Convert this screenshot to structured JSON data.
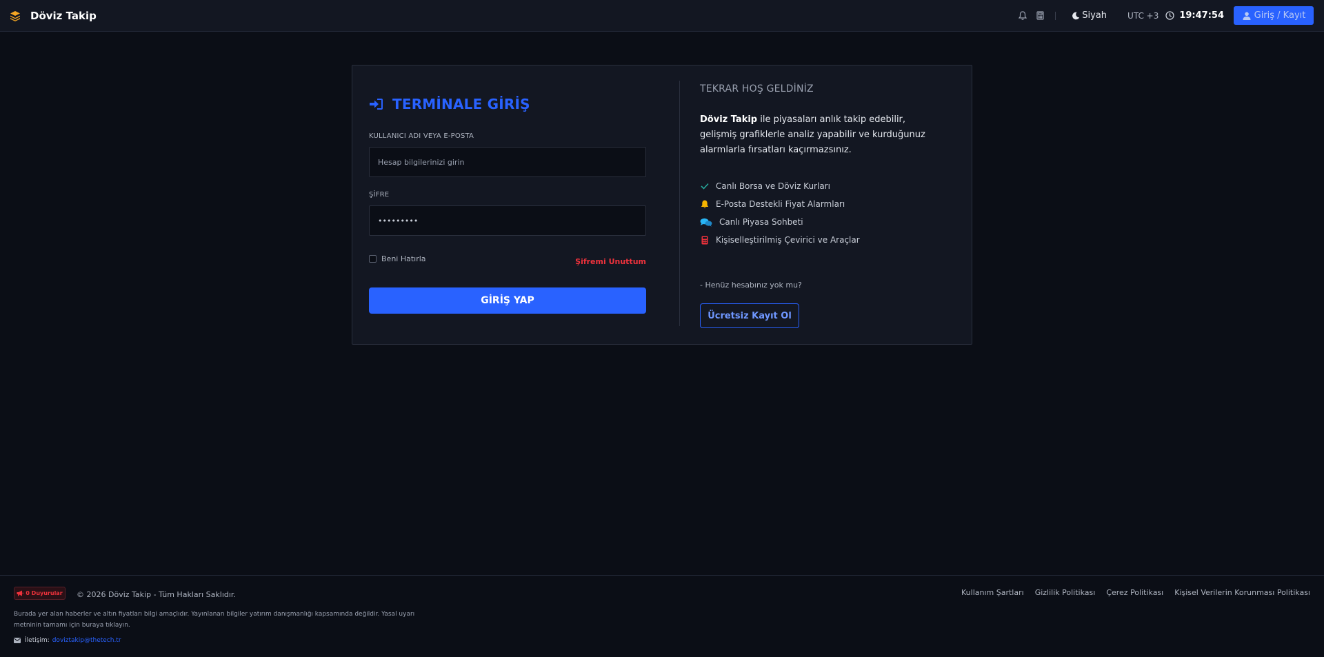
{
  "header": {
    "brand": "Döviz Takip",
    "theme_label": "Siyah",
    "utc_label": "UTC +3",
    "time": "19:47:54",
    "login_button": "Giriş / Kayıt"
  },
  "login": {
    "title": "TERMİNALE GİRİŞ",
    "username_label": "KULLANICI ADI VEYA E-POSTA",
    "username_placeholder": "Hesap bilgilerinizi girin",
    "password_label": "ŞİFRE",
    "password_value": "•••••••••",
    "remember_label": "Beni Hatırla",
    "forgot_link": "Şifremi Unuttum",
    "submit_button": "GİRİŞ YAP"
  },
  "welcome": {
    "heading": "TEKRAR HOŞ GELDİNİZ",
    "brand_bold": "Döviz Takip",
    "description": " ile piyasaları anlık takip edebilir, gelişmiş grafiklerle analiz yapabilir ve kurduğunuz alarmlarla fırsatları kaçırmazsınız.",
    "features": [
      {
        "icon": "check-icon",
        "color": "#26a69a",
        "label": "Canlı Borsa ve Döviz Kurları"
      },
      {
        "icon": "bell-icon",
        "color": "#f5b400",
        "label": "E-Posta Destekli Fiyat Alarmları"
      },
      {
        "icon": "chat-icon",
        "color": "#29b6f6",
        "label": "Canlı Piyasa Sohbeti"
      },
      {
        "icon": "calculator-icon",
        "color": "#f0323c",
        "label": "Kişiselleştirilmiş Çevirici ve Araçlar"
      }
    ],
    "no_account": "- Henüz hesabınız yok mu?",
    "register_button": "Ücretsiz Kayıt Ol"
  },
  "footer": {
    "announcements": "0 Duyurular",
    "copyright": "© 2026 Döviz Takip - Tüm Hakları Saklıdır.",
    "links": [
      "Kullanım Şartları",
      "Gizlilik Politikası",
      "Çerez Politikası",
      "Kişisel Verilerin Korunması Politikası"
    ],
    "disclaimer": "Burada yer alan haberler ve altın fiyatları bilgi amaçlıdır. Yayınlanan bilgiler yatırım danışmanlığı kapsamında değildir. Yasal uyarı metninin tamamı için buraya tıklayın.",
    "contact_label": "İletişim:",
    "contact_email": "doviztakip@thetech.tr"
  },
  "colors": {
    "accent": "#2962ff",
    "danger": "#f0323c",
    "background": "#0b0e16",
    "panel": "#131722"
  }
}
